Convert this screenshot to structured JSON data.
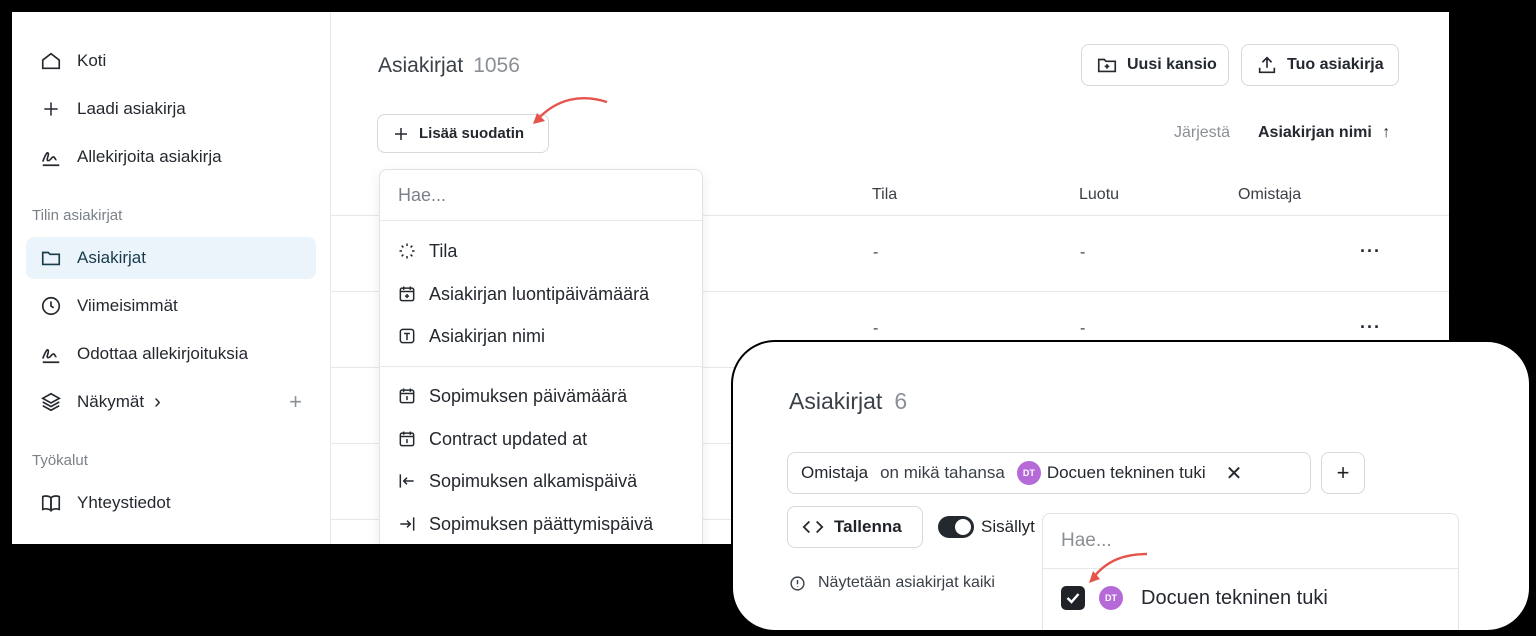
{
  "sidebar": {
    "items": [
      {
        "label": "Koti",
        "icon": "home-icon"
      },
      {
        "label": "Laadi asiakirja",
        "icon": "plus-icon"
      },
      {
        "label": "Allekirjoita asiakirja",
        "icon": "signature-icon"
      }
    ],
    "section_account": "Tilin asiakirjat",
    "account_items": [
      {
        "label": "Asiakirjat",
        "icon": "folder-icon",
        "active": true
      },
      {
        "label": "Viimeisimmät",
        "icon": "clock-icon"
      },
      {
        "label": "Odottaa allekirjoituksia",
        "icon": "signature-icon"
      },
      {
        "label": "Näkymät",
        "icon": "layers-icon",
        "chevron": "›"
      }
    ],
    "section_tools": "Työkalut",
    "tools_items": [
      {
        "label": "Yhteystiedot",
        "icon": "book-icon"
      }
    ]
  },
  "main": {
    "title": "Asiakirjat",
    "count": "1056",
    "new_folder_label": "Uusi kansio",
    "import_label": "Tuo asiakirja",
    "add_filter_label": "Lisää suodatin",
    "sort_label": "Järjestä",
    "sort_value": "Asiakirjan nimi",
    "columns": [
      "Tila",
      "Luotu",
      "Omistaja"
    ],
    "rows": [
      {
        "tila": "-",
        "luotu": "-",
        "menu": "···"
      },
      {
        "tila": "-",
        "luotu": "-",
        "menu": "···"
      }
    ]
  },
  "filter_dropdown": {
    "search_placeholder": "Hae...",
    "group1": [
      {
        "label": "Tila",
        "icon": "loader-icon"
      },
      {
        "label": "Asiakirjan luontipäivämäärä",
        "icon": "calendar-plus-icon"
      },
      {
        "label": "Asiakirjan nimi",
        "icon": "text-box-icon"
      }
    ],
    "group2": [
      {
        "label": "Sopimuksen päivämäärä",
        "icon": "calendar-icon"
      },
      {
        "label": "Contract updated at",
        "icon": "calendar-icon"
      },
      {
        "label": "Sopimuksen alkamispäivä",
        "icon": "arrow-left-bar-icon"
      },
      {
        "label": "Sopimuksen päättymispäivä",
        "icon": "arrow-right-bar-icon"
      }
    ]
  },
  "inset": {
    "title": "Asiakirjat",
    "count": "6",
    "filter_field": "Omistaja",
    "filter_op": "on mikä tahansa",
    "avatar_initials": "DT",
    "filter_value": "Docuen tekninen tuki",
    "save_label": "Tallenna",
    "include_label": "Sisällyt",
    "info_text": "Näytetään asiakirjat kaiki",
    "popup_search_placeholder": "Hae...",
    "popup_option": "Docuen tekninen tuki"
  },
  "colors": {
    "accent_active_bg": "#eaf4fa",
    "avatar": "#b66ad8",
    "annotation_arrow": "#e5534b"
  }
}
